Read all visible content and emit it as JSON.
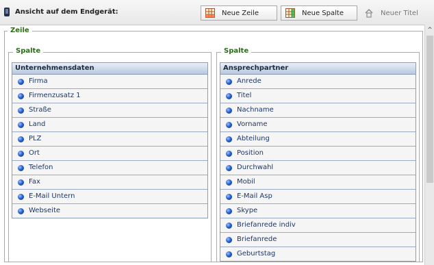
{
  "toolbar": {
    "title": "Ansicht auf dem Endgerät:",
    "new_row_label": "Neue Zeile",
    "new_column_label": "Neue Spalte",
    "new_title_label": "Neuer Titel"
  },
  "row_legend": "Zeile",
  "columns": [
    {
      "legend": "Spalte",
      "header": "Unternehmensdaten",
      "items": [
        "Firma",
        "Firmenzusatz 1",
        "Straße",
        "Land",
        "PLZ",
        "Ort",
        "Telefon",
        "Fax",
        "E-Mail Untern",
        "Webseite"
      ]
    },
    {
      "legend": "Spalte",
      "header": "Ansprechpartner",
      "items": [
        "Anrede",
        "Titel",
        "Nachname",
        "Vorname",
        "Abteilung",
        "Position",
        "Durchwahl",
        "Mobil",
        "E-Mail Asp",
        "Skype",
        "Briefanrede indiv",
        "Briefanrede",
        "Geburtstag"
      ]
    }
  ],
  "icons": {
    "device": "phone-icon",
    "new_row": "grid-add-row-icon",
    "new_column": "grid-add-column-icon",
    "new_title": "house-icon",
    "field_marker": "blue-dot-icon"
  },
  "colors": {
    "legend_green": "#2d6b18",
    "header_blue": "#b8c8dd",
    "dot_blue": "#2a62d1"
  }
}
